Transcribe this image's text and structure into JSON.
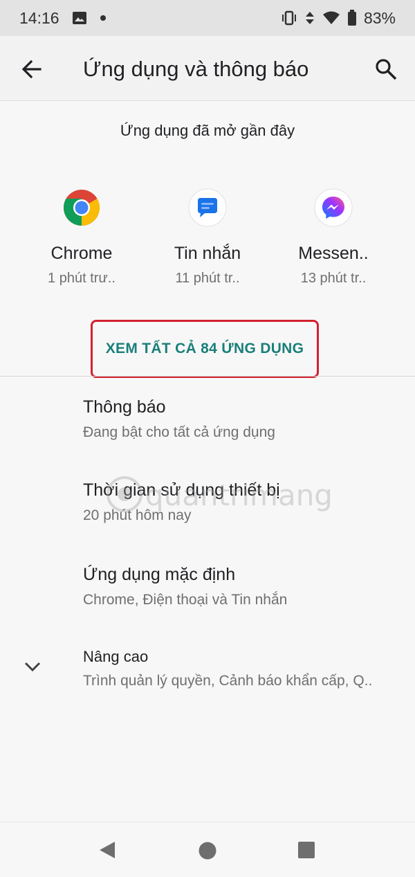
{
  "status_bar": {
    "time": "14:16",
    "battery": "83%",
    "icons": [
      "image-icon",
      "dot-icon",
      "vibrate-icon",
      "data-icon",
      "wifi-icon",
      "battery-icon"
    ]
  },
  "app_bar": {
    "title": "Ứng dụng và thông báo",
    "back_icon": "arrow-left-icon",
    "search_icon": "search-icon"
  },
  "recent_apps": {
    "header": "Ứng dụng đã mở gần đây",
    "items": [
      {
        "name": "Chrome",
        "time": "1 phút trư..",
        "icon": "chrome-icon"
      },
      {
        "name": "Tin nhắn",
        "time": "11 phút tr..",
        "icon": "messages-icon"
      },
      {
        "name": "Messen..",
        "time": "13 phút tr..",
        "icon": "messenger-icon"
      }
    ],
    "see_all": "XEM TẤT CẢ 84 ỨNG DỤNG"
  },
  "settings": [
    {
      "title": "Thông báo",
      "subtitle": "Đang bật cho tất cả ứng dụng"
    },
    {
      "title": "Thời gian sử dụng thiết bị",
      "subtitle": "20 phút hôm nay"
    },
    {
      "title": "Ứng dụng mặc định",
      "subtitle": "Chrome, Điện thoại và Tin nhắn"
    },
    {
      "title": "Nâng cao",
      "subtitle": "Trình quản lý quyền, Cảnh báo khẩn cấp, Q.."
    }
  ],
  "watermark": "quantrimang",
  "colors": {
    "accent": "#1a7f7a",
    "highlight_border": "#d3202e",
    "status_bar_bg": "#e3e3e3"
  },
  "nav_bar": {
    "icons": [
      "nav-back-icon",
      "nav-home-icon",
      "nav-recents-icon"
    ]
  }
}
